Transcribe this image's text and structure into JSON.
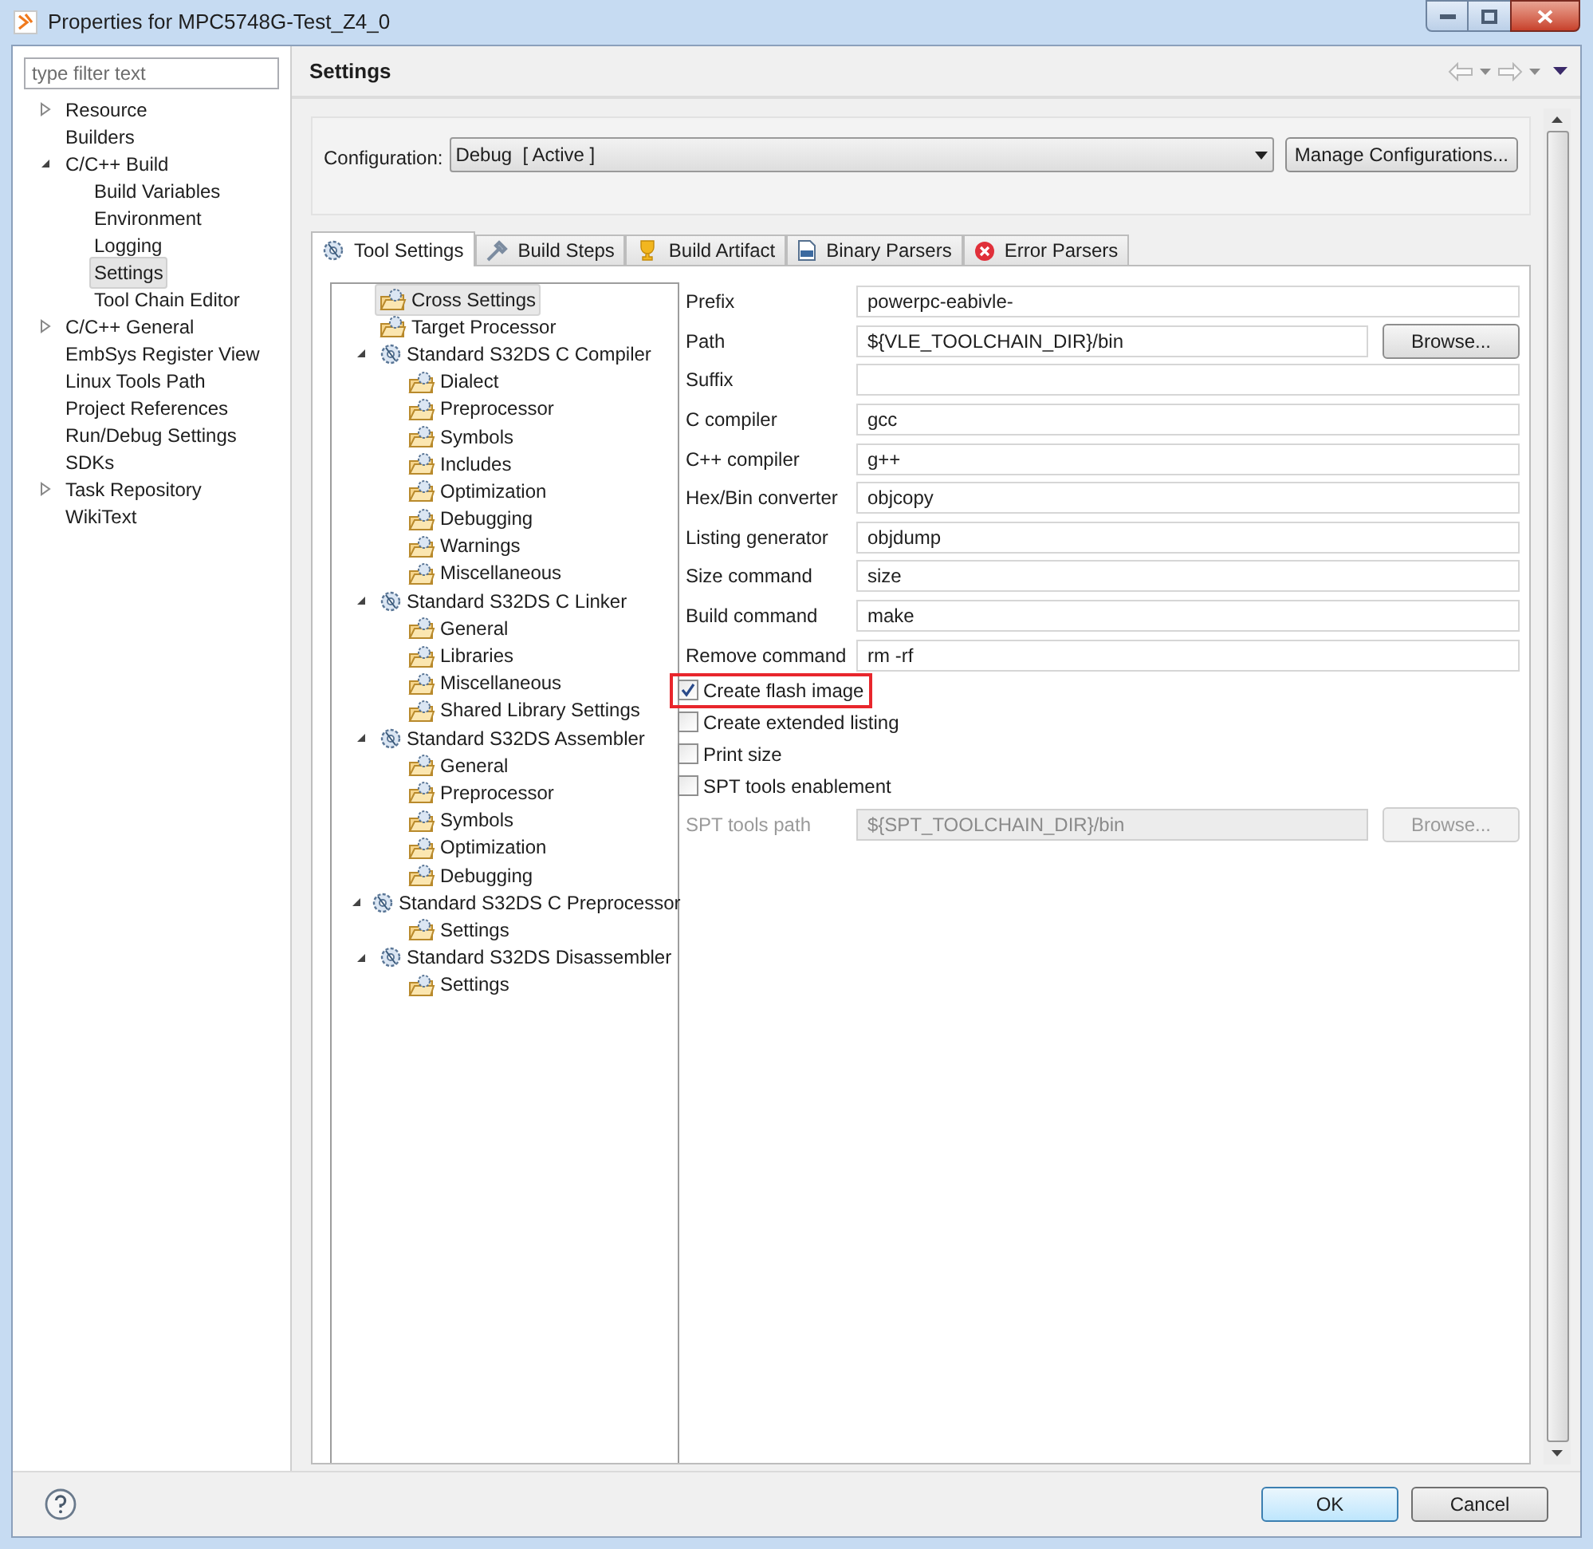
{
  "window": {
    "title": "Properties for MPC5748G-Test_Z4_0"
  },
  "sidebar": {
    "filter": {
      "placeholder": "type filter text"
    },
    "items": [
      {
        "label": "Resource",
        "expanded": false,
        "selected": false
      },
      {
        "label": "Builders",
        "selected": false
      },
      {
        "label": "C/C++ Build",
        "expanded": true,
        "selected": false,
        "children": [
          {
            "label": "Build Variables",
            "selected": false
          },
          {
            "label": "Environment",
            "selected": false
          },
          {
            "label": "Logging",
            "selected": false
          },
          {
            "label": "Settings",
            "selected": true
          },
          {
            "label": "Tool Chain Editor",
            "selected": false
          }
        ]
      },
      {
        "label": "C/C++ General",
        "expanded": false,
        "selected": false
      },
      {
        "label": "EmbSys Register View",
        "selected": false
      },
      {
        "label": "Linux Tools Path",
        "selected": false
      },
      {
        "label": "Project References",
        "selected": false
      },
      {
        "label": "Run/Debug Settings",
        "selected": false
      },
      {
        "label": "SDKs",
        "selected": false
      },
      {
        "label": "Task Repository",
        "expanded": false,
        "selected": false
      },
      {
        "label": "WikiText",
        "selected": false
      }
    ]
  },
  "page": {
    "title": "Settings"
  },
  "configuration": {
    "label": "Configuration:",
    "value": "Debug  [ Active ]",
    "button": "Manage Configurations..."
  },
  "tabs": [
    {
      "label": "Tool Settings",
      "kind": "gear",
      "selected": true
    },
    {
      "label": "Build Steps",
      "kind": "steps",
      "selected": false
    },
    {
      "label": "Build Artifact",
      "kind": "trophy",
      "selected": false
    },
    {
      "label": "Binary Parsers",
      "kind": "binary",
      "selected": false
    },
    {
      "label": "Error Parsers",
      "kind": "error",
      "selected": false
    }
  ],
  "tool_tree": [
    {
      "label": "Cross Settings",
      "kind": "option",
      "selected": true
    },
    {
      "label": "Target Processor",
      "kind": "option",
      "selected": false
    },
    {
      "label": "Standard S32DS C Compiler",
      "kind": "tool",
      "expanded": true,
      "selected": false,
      "children": [
        {
          "label": "Dialect",
          "kind": "option",
          "selected": false
        },
        {
          "label": "Preprocessor",
          "kind": "option",
          "selected": false
        },
        {
          "label": "Symbols",
          "kind": "option",
          "selected": false
        },
        {
          "label": "Includes",
          "kind": "option",
          "selected": false
        },
        {
          "label": "Optimization",
          "kind": "option",
          "selected": false
        },
        {
          "label": "Debugging",
          "kind": "option",
          "selected": false
        },
        {
          "label": "Warnings",
          "kind": "option",
          "selected": false
        },
        {
          "label": "Miscellaneous",
          "kind": "option",
          "selected": false
        }
      ]
    },
    {
      "label": "Standard S32DS C Linker",
      "kind": "tool",
      "expanded": true,
      "selected": false,
      "children": [
        {
          "label": "General",
          "kind": "option",
          "selected": false
        },
        {
          "label": "Libraries",
          "kind": "option",
          "selected": false
        },
        {
          "label": "Miscellaneous",
          "kind": "option",
          "selected": false
        },
        {
          "label": "Shared Library Settings",
          "kind": "option",
          "selected": false
        }
      ]
    },
    {
      "label": "Standard S32DS Assembler",
      "kind": "tool",
      "expanded": true,
      "selected": false,
      "children": [
        {
          "label": "General",
          "kind": "option",
          "selected": false
        },
        {
          "label": "Preprocessor",
          "kind": "option",
          "selected": false
        },
        {
          "label": "Symbols",
          "kind": "option",
          "selected": false
        },
        {
          "label": "Optimization",
          "kind": "option",
          "selected": false
        },
        {
          "label": "Debugging",
          "kind": "option",
          "selected": false
        }
      ]
    },
    {
      "label": "Standard S32DS C Preprocessor",
      "kind": "tool",
      "expanded": true,
      "selected": false,
      "children": [
        {
          "label": "Settings",
          "kind": "option",
          "selected": false
        }
      ]
    },
    {
      "label": "Standard S32DS Disassembler",
      "kind": "tool",
      "expanded": true,
      "selected": false,
      "children": [
        {
          "label": "Settings",
          "kind": "option",
          "selected": false
        }
      ]
    }
  ],
  "settings": [
    {
      "kind": "text",
      "label": "Prefix",
      "value": "powerpc-eabivle-"
    },
    {
      "kind": "browse",
      "label": "Path",
      "value": "${VLE_TOOLCHAIN_DIR}/bin",
      "button": "Browse...",
      "disabled": false
    },
    {
      "kind": "text",
      "label": "Suffix"
    },
    {
      "kind": "text",
      "label": "C compiler",
      "value": "gcc"
    },
    {
      "kind": "text",
      "label": "C++ compiler",
      "value": "g++"
    },
    {
      "kind": "text",
      "label": "Hex/Bin converter",
      "value": "objcopy"
    },
    {
      "kind": "text",
      "label": "Listing generator",
      "value": "objdump"
    },
    {
      "kind": "text",
      "label": "Size command",
      "value": "size"
    },
    {
      "kind": "text",
      "label": "Build command",
      "value": "make"
    },
    {
      "kind": "text",
      "label": "Remove command",
      "value": "rm -rf"
    },
    {
      "kind": "checkbox",
      "label": "Create flash image",
      "checked": true,
      "highlighted": true
    },
    {
      "kind": "checkbox",
      "label": "Create extended listing",
      "checked": false,
      "highlighted": false
    },
    {
      "kind": "checkbox",
      "label": "Print size",
      "checked": false,
      "highlighted": false
    },
    {
      "kind": "checkbox",
      "label": "SPT tools enablement",
      "checked": false,
      "highlighted": false
    },
    {
      "kind": "browse",
      "label": "SPT tools path",
      "value": "${SPT_TOOLCHAIN_DIR}/bin",
      "button": "Browse...",
      "disabled": true
    }
  ],
  "buttons": [
    {
      "label": "OK",
      "default": true
    },
    {
      "label": "Cancel",
      "default": false
    }
  ]
}
